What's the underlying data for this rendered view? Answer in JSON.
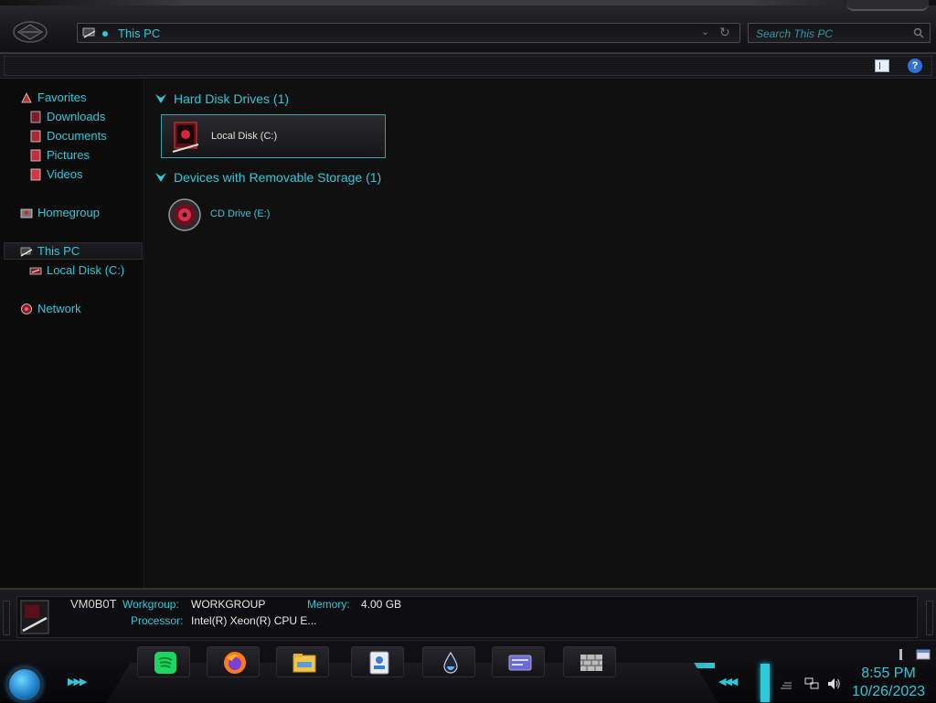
{
  "address": {
    "path": "This PC",
    "search_placeholder": "Search This PC"
  },
  "toolbar": {
    "help_label": "?"
  },
  "sidebar": {
    "favorites": "Favorites",
    "favorites_items": [
      "Downloads",
      "Documents",
      "Pictures",
      "Videos"
    ],
    "homegroup": "Homegroup",
    "this_pc": "This PC",
    "this_pc_items": [
      "Local Disk (C:)"
    ],
    "network": "Network"
  },
  "groups": [
    {
      "title": "Hard Disk Drives (1)",
      "items": [
        "Local Disk (C:)"
      ]
    },
    {
      "title": "Devices with Removable Storage (1)",
      "items": [
        "CD Drive (E:)"
      ]
    }
  ],
  "details": {
    "computer_name": "VM0B0T",
    "workgroup_label": "Workgroup:",
    "workgroup_value": "WORKGROUP",
    "memory_label": "Memory:",
    "memory_value": "4.00 GB",
    "processor_label": "Processor:",
    "processor_value": "Intel(R) Xeon(R) CPU E..."
  },
  "taskbar": {
    "pinned": [
      "spotify-icon",
      "firefox-icon",
      "file-explorer-icon",
      "contacts-icon",
      "water-drop-icon",
      "id-card-icon",
      "firewall-icon"
    ],
    "clock_time": "8:55 PM",
    "clock_date": "10/26/2023"
  },
  "colors": {
    "accent": "#2ec8d8",
    "background": "#0c0c0d",
    "start_orb": "#1e7fc8"
  }
}
